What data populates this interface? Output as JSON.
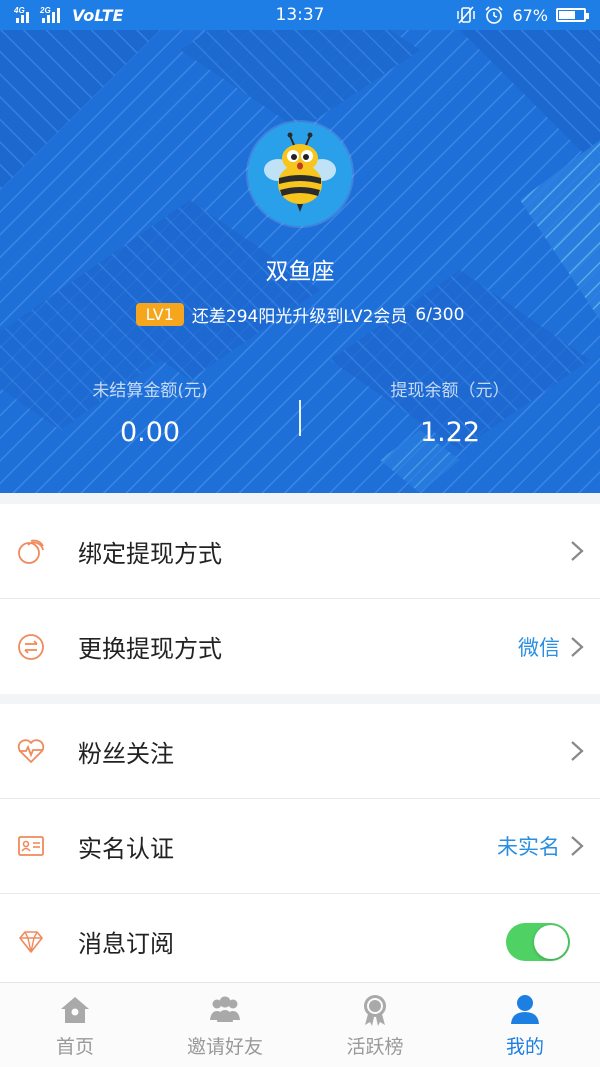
{
  "status_bar": {
    "network_small_top": "4G",
    "network_small_bottom": "2G",
    "volte": "VoLTE",
    "time": "13:37",
    "battery": "67%",
    "battery_level": 0.67
  },
  "profile": {
    "username": "双鱼座",
    "level_badge": "LV1",
    "level_text": "还差294阳光升级到LV2会员",
    "level_progress": "6/300",
    "stats": {
      "unsettled_label": "未结算金额(元)",
      "unsettled_value": "0.00",
      "withdrawable_label": "提现余额（元）",
      "withdrawable_value": "1.22"
    }
  },
  "menu": {
    "section1": [
      {
        "label": "绑定提现方式",
        "icon": "coins-icon",
        "value": ""
      },
      {
        "label": "更换提现方式",
        "icon": "exchange-icon",
        "value": "微信"
      }
    ],
    "section2": [
      {
        "label": "粉丝关注",
        "icon": "heart-pulse-icon",
        "value": ""
      },
      {
        "label": "实名认证",
        "icon": "id-card-icon",
        "value": "未实名"
      },
      {
        "label": "消息订阅",
        "icon": "diamond-icon",
        "value": "",
        "toggle": true
      }
    ]
  },
  "tabbar": {
    "items": [
      {
        "label": "首页",
        "icon": "home-icon",
        "active": false
      },
      {
        "label": "邀请好友",
        "icon": "people-icon",
        "active": false
      },
      {
        "label": "活跃榜",
        "icon": "medal-icon",
        "active": false
      },
      {
        "label": "我的",
        "icon": "person-icon",
        "active": true
      }
    ]
  },
  "colors": {
    "header_blue": "#1f6fd8",
    "accent_blue": "#1d7fe2",
    "badge_orange": "#f6a61c",
    "icon_orange": "#f08a5c",
    "toggle_green": "#4fd164"
  }
}
